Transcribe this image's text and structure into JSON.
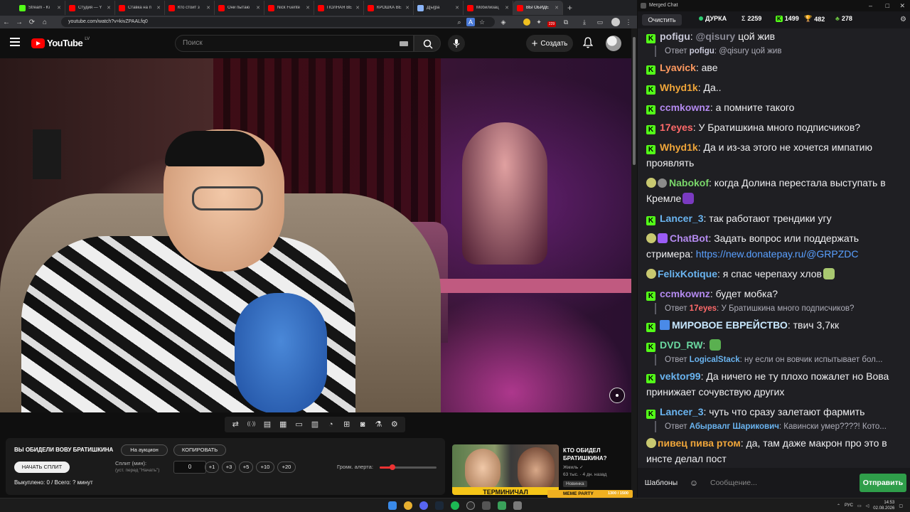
{
  "browser": {
    "tabs": [
      {
        "title": "Stream - Ki",
        "color": "#53fc18"
      },
      {
        "title": "Студия — Y",
        "color": "#ff0000"
      },
      {
        "title": "Ставка на п",
        "color": "#ff0000"
      },
      {
        "title": "Кто стоит з",
        "color": "#ff0000"
      },
      {
        "title": "Они пытаю",
        "color": "#ff0000"
      },
      {
        "title": "Nick Fuente",
        "color": "#ff0000"
      },
      {
        "title": "ПОЛНАЯ ВЕ",
        "color": "#ff0000"
      },
      {
        "title": "КРОШКА ВЕ",
        "color": "#ff0000"
      },
      {
        "title": "Д[ы]ра",
        "color": "#8ab4f8"
      },
      {
        "title": "Мобилизац",
        "color": "#ff0000"
      },
      {
        "title": "ВЫ ОБИДЕ",
        "color": "#ff0000",
        "active": true
      }
    ],
    "url": "youtube.com/watch?v=kivZPAALfq0",
    "extension_count": "229"
  },
  "youtube": {
    "logo_text": "YouTube",
    "region": "LV",
    "search_placeholder": "Поиск",
    "create_label": "Создать"
  },
  "player_tools": [
    "repeat-icon",
    "radio-icon",
    "screen-icon",
    "clapper-icon",
    "frame-icon",
    "bars-icon",
    "speed-icon",
    "add-box-icon",
    "camera-icon",
    "flask-icon",
    "gear-icon"
  ],
  "extension": {
    "title": "ВЫ ОБИДЕЛИ ВОВУ БРАТИШКИНА",
    "auction_label": "На аукцион",
    "copy_label": "КОПИРОВАТЬ",
    "start_split_label": "НАЧАТЬ СПЛИТ",
    "split_label": "Сплит (мин):",
    "split_hint": "(уст. перед \"Начать\")",
    "split_value": "0",
    "increments": [
      "+1",
      "+3",
      "+5",
      "+10",
      "+20"
    ],
    "volume_label": "Громк. алерта:",
    "volume_level": 0.22,
    "bought_text": "Выкуплено: 0 / Всего: ? минут"
  },
  "recommendation": {
    "title": "КТО ОБИДЕЛ БРАТИШКИНА?",
    "channel": "Жмиль",
    "stats": "63 тыс. · 4 дн. назад",
    "badge": "Новинка",
    "thumb_caption": "ТЕРМИНИЧАЛ"
  },
  "meme_party": {
    "label": "MEME PARTY",
    "count": "1300 / 1500"
  },
  "chat": {
    "window_title": "Merged Chat",
    "clear_label": "Очистить",
    "channel": "ДУРКА",
    "stats": [
      {
        "icon": "sigma-icon",
        "value": "2259"
      },
      {
        "icon": "kick-icon",
        "value": "1499"
      },
      {
        "icon": "trophy-icon",
        "value": "482"
      },
      {
        "icon": "tree-icon",
        "value": "278"
      }
    ],
    "messages": [
      {
        "user": "pofigu",
        "color": "#c8c8d8",
        "badge": "kick",
        "text": "@qisury цой жив",
        "mention": "@qisury"
      },
      {
        "reply": true,
        "reply_user": "pofigu",
        "reply_text": "@qisury цой жив",
        "reply_color": "#c8c8d8"
      },
      {
        "user": "Lyavick",
        "color": "#ff9a60",
        "badge": "kick",
        "text": "аве"
      },
      {
        "user": "Whyd1k",
        "color": "#f0a63a",
        "badge": "kick",
        "text": "Да.."
      },
      {
        "user": "ccmkownz",
        "color": "#b48af0",
        "badge": "kick",
        "text": "а помните такого"
      },
      {
        "user": "17eyes",
        "color": "#ff6a6a",
        "badge": "kick",
        "text": "У Братишкина много подписчиков?"
      },
      {
        "user": "Whyd1k",
        "color": "#f0a63a",
        "badge": "kick",
        "text": "Да и из-за этого не хочется импатию проявлять"
      },
      {
        "user": "Nabokof",
        "color": "#7ad86a",
        "badge": "emo-chk",
        "text": "когда Долина перестала выступать в Кремле",
        "emote": "#7a3ac0"
      },
      {
        "user": "Lancer_3",
        "color": "#6ab4f0",
        "badge": "kick",
        "text": "так работают трендики угу"
      },
      {
        "user": "ChatBot",
        "color": "#b48af0",
        "badge": "emo-bot",
        "text": "Задать вопрос или поддержать стримера:",
        "link": "https://new.donatepay.ru/@GRPZDC"
      },
      {
        "user": "FelixKotique",
        "color": "#6ab4f0",
        "badge": "emo",
        "text": "я спас черепаху хлов",
        "emote": "#a8c870"
      },
      {
        "user": "ccmkownz",
        "color": "#b48af0",
        "badge": "kick",
        "text": "будет мобка?"
      },
      {
        "reply": true,
        "reply_user": "17eyes",
        "reply_text": "У Братишкина много подписчиков?",
        "reply_color": "#ff6a6a"
      },
      {
        "user": "МИРОВОЕ ЕВРЕЙСТВО",
        "color": "#c8e8ff",
        "badge": "kick-blue",
        "text": "твич 3,7кк"
      },
      {
        "user": "DVD_RW",
        "color": "#6ad8a0",
        "badge": "kick",
        "text": "",
        "emote": "#5ab050"
      },
      {
        "reply": true,
        "reply_user": "LogicalStack",
        "reply_text": "ну если он вовчик испытывает бол...",
        "reply_color": "#6ab4f0"
      },
      {
        "user": "vektor99",
        "color": "#6ab4f0",
        "badge": "kick",
        "text": "Да ничего не ту плохо пожалет но Вова принижает сочувствую других"
      },
      {
        "user": "Lancer_3",
        "color": "#6ab4f0",
        "badge": "kick",
        "text": "чуть что сразу залетают фармить"
      },
      {
        "reply": true,
        "reply_user": "Абырвалг Шарикович",
        "reply_text": "Кавински умер????! Кото...",
        "reply_color": "#6ab4f0"
      },
      {
        "user": "пивец пива ртом",
        "color": "#f0a63a",
        "badge": "emo",
        "text": "да, там даже макрон про это в инсте делал пост"
      }
    ],
    "templates_label": "Шаблоны",
    "message_placeholder": "Сообщение...",
    "send_label": "Отправить"
  },
  "taskbar": {
    "lang": "РУС",
    "time": "14:53",
    "date": "02.08.2026"
  }
}
